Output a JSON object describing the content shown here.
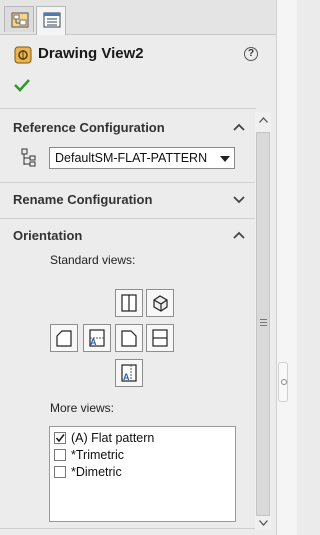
{
  "panel": {
    "title": "Drawing View2",
    "icons": {
      "title": "drawing-view-icon",
      "help": "help-icon",
      "ok": "checkmark-icon"
    },
    "help_glyph": "?"
  },
  "tabs": [
    {
      "icon": "feature-manager-icon",
      "active": false
    },
    {
      "icon": "property-manager-icon",
      "active": true
    }
  ],
  "sections": {
    "reference_configuration": {
      "title": "Reference Configuration",
      "expanded": true,
      "dropdown_value": "DefaultSM-FLAT-PATTERN"
    },
    "rename_configuration": {
      "title": "Rename Configuration",
      "expanded": false
    },
    "orientation": {
      "title": "Orientation",
      "expanded": true,
      "standard_views_label": "Standard views:",
      "view_buttons": [
        "front-view-icon",
        "isometric-view-icon",
        "left-view-icon",
        "top-view-icon",
        "right-view-icon",
        "bottom-view-icon",
        "back-view-icon"
      ],
      "more_views_label": "More views:",
      "more_views": [
        {
          "label": "(A) Flat pattern",
          "checked": true
        },
        {
          "label": "*Trimetric",
          "checked": false
        },
        {
          "label": "*Dimetric",
          "checked": false
        }
      ]
    }
  },
  "colors": {
    "accent_check": "#2e9a2e",
    "icon_gold": "#d9a43a"
  }
}
